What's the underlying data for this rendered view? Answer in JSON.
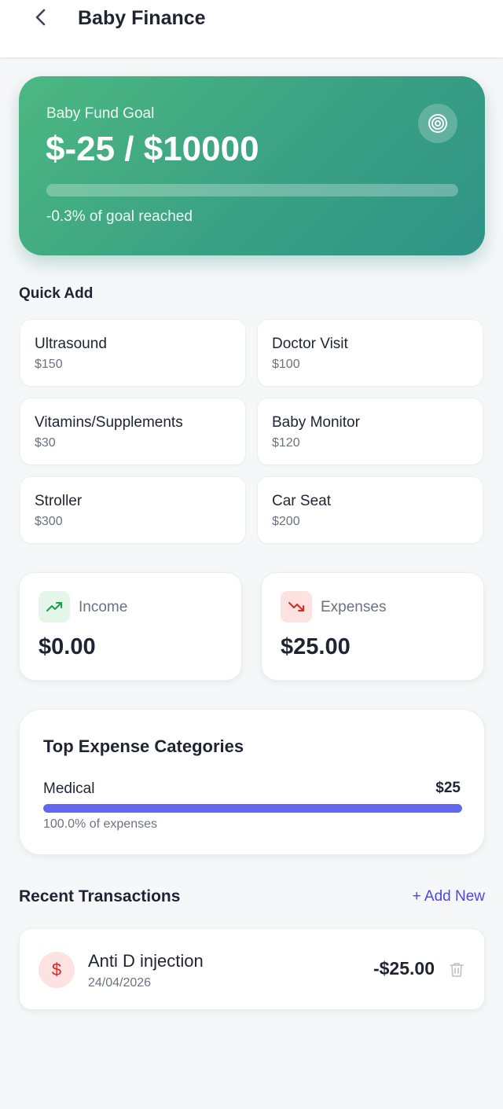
{
  "header": {
    "title": "Baby Finance",
    "back_icon": "chevron-left-icon"
  },
  "goal": {
    "label": "Baby Fund Goal",
    "amount_text": "$-25 / $10000",
    "current": -25,
    "target": 10000,
    "progress_fraction": 0,
    "reached_text": "-0.3% of goal reached",
    "icon": "target-icon"
  },
  "quick_add": {
    "title": "Quick Add",
    "items": [
      {
        "name": "Ultrasound",
        "price": "$150"
      },
      {
        "name": "Doctor Visit",
        "price": "$100"
      },
      {
        "name": "Vitamins/Supplements",
        "price": "$30"
      },
      {
        "name": "Baby Monitor",
        "price": "$120"
      },
      {
        "name": "Stroller",
        "price": "$300"
      },
      {
        "name": "Car Seat",
        "price": "$200"
      }
    ]
  },
  "stats": {
    "income": {
      "label": "Income",
      "value": "$0.00",
      "icon": "trending-up-icon",
      "color": "#16a34a",
      "bg": "#e4f6ea"
    },
    "expenses": {
      "label": "Expenses",
      "value": "$25.00",
      "icon": "trending-down-icon",
      "color": "#dc2626",
      "bg": "#fde2e2"
    }
  },
  "categories": {
    "title": "Top Expense Categories",
    "items": [
      {
        "name": "Medical",
        "amount": "$25",
        "percent_text": "100.0% of expenses",
        "fraction": 1.0,
        "color": "#6366f1"
      }
    ]
  },
  "transactions": {
    "title": "Recent Transactions",
    "add_label": "+ Add New",
    "items": [
      {
        "name": "Anti D injection",
        "date": "24/04/2026",
        "amount": "-$25.00",
        "icon": "dollar-icon",
        "icon_glyph": "$",
        "delete_icon": "trash-icon"
      }
    ]
  },
  "colors": {
    "accent": "#4f46e5",
    "goal_gradient_start": "#4cb882",
    "goal_gradient_end": "#2f9386",
    "background": "#f6f7f9"
  }
}
